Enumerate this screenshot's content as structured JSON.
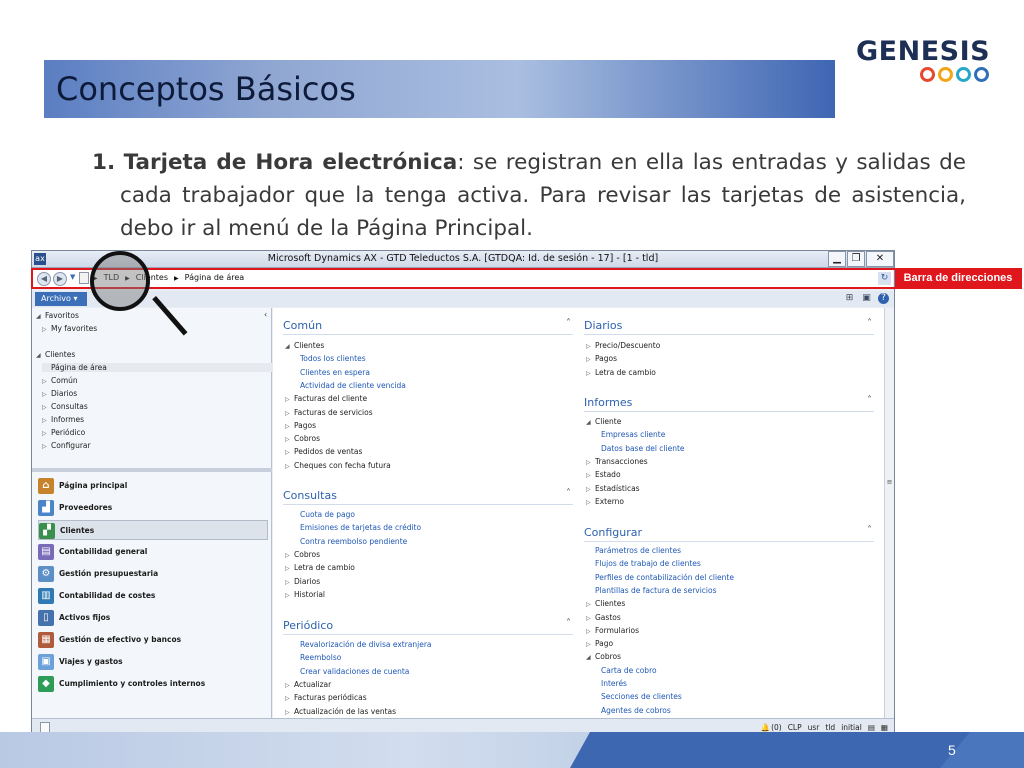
{
  "slide": {
    "title": "Conceptos Básicos",
    "logo_text": "GENESIS",
    "logo_ring_colors": [
      "#e64a2e",
      "#f2a516",
      "#26a7c9",
      "#2e6fb8"
    ],
    "page_number": "5"
  },
  "paragraph": {
    "number": "1.",
    "term": "Tarjeta de Hora electrónica",
    "text": ": se registran en ella las entradas y salidas de cada trabajador que la tenga activa. Para revisar las tarjetas de asistencia, debo ir al menú de la Página Principal."
  },
  "ax": {
    "window_title": "Microsoft Dynamics AX - GTD Teleductos S.A. [GTDQA: Id. de sesión - 17] -  [1 - tld]",
    "breadcrumbs": [
      "TLD",
      "Clientes",
      "Página de área"
    ],
    "callout_label": "Barra de direcciones",
    "archivo_label": "Archivo",
    "nav_tree": [
      {
        "label": "Favoritos",
        "kind": "group"
      },
      {
        "label": "My favorites",
        "kind": "child"
      },
      {
        "label": "Clientes",
        "kind": "group"
      },
      {
        "label": "Página de área",
        "kind": "selected"
      },
      {
        "label": "Común",
        "kind": "child"
      },
      {
        "label": "Diarios",
        "kind": "child"
      },
      {
        "label": "Consultas",
        "kind": "child"
      },
      {
        "label": "Informes",
        "kind": "child"
      },
      {
        "label": "Periódico",
        "kind": "child"
      },
      {
        "label": "Configurar",
        "kind": "child"
      }
    ],
    "modules": [
      {
        "label": "Página principal",
        "icon": "home-icon"
      },
      {
        "label": "Proveedores",
        "icon": "vendors-icon"
      },
      {
        "label": "Clientes",
        "icon": "customers-icon"
      },
      {
        "label": "Contabilidad general",
        "icon": "ledger-icon"
      },
      {
        "label": "Gestión presupuestaria",
        "icon": "budget-icon"
      },
      {
        "label": "Contabilidad de costes",
        "icon": "cost-icon"
      },
      {
        "label": "Activos fijos",
        "icon": "fixed-assets-icon"
      },
      {
        "label": "Gestión de efectivo y bancos",
        "icon": "bank-icon"
      },
      {
        "label": "Viajes y gastos",
        "icon": "travel-icon"
      },
      {
        "label": "Cumplimiento y controles internos",
        "icon": "compliance-icon"
      }
    ],
    "comun": {
      "title": "Común",
      "items": [
        {
          "label": "Clientes",
          "type": "open"
        },
        {
          "label": "Todos los clientes",
          "type": "link"
        },
        {
          "label": "Clientes en espera",
          "type": "link"
        },
        {
          "label": "Actividad de cliente vencida",
          "type": "link"
        },
        {
          "label": "Facturas del cliente",
          "type": "closed"
        },
        {
          "label": "Facturas de servicios",
          "type": "closed"
        },
        {
          "label": "Pagos",
          "type": "closed"
        },
        {
          "label": "Cobros",
          "type": "closed"
        },
        {
          "label": "Pedidos de ventas",
          "type": "closed"
        },
        {
          "label": "Cheques con fecha futura",
          "type": "closed"
        }
      ]
    },
    "consultas": {
      "title": "Consultas",
      "items": [
        {
          "label": "Cuota de pago",
          "type": "link"
        },
        {
          "label": "Emisiones de tarjetas de crédito",
          "type": "link"
        },
        {
          "label": "Contra reembolso pendiente",
          "type": "link"
        },
        {
          "label": "Cobros",
          "type": "closed"
        },
        {
          "label": "Letra de cambio",
          "type": "closed"
        },
        {
          "label": "Diarios",
          "type": "closed"
        },
        {
          "label": "Historial",
          "type": "closed"
        }
      ]
    },
    "periodico": {
      "title": "Periódico",
      "items": [
        {
          "label": "Revalorización de divisa extranjera",
          "type": "link"
        },
        {
          "label": "Reembolso",
          "type": "link"
        },
        {
          "label": "Crear validaciones de cuenta",
          "type": "link"
        },
        {
          "label": "Actualizar",
          "type": "closed"
        },
        {
          "label": "Facturas periódicas",
          "type": "closed"
        },
        {
          "label": "Actualización de las ventas",
          "type": "closed"
        }
      ]
    },
    "diarios": {
      "title": "Diarios",
      "items": [
        {
          "label": "Precio/Descuento",
          "type": "closed"
        },
        {
          "label": "Pagos",
          "type": "closed"
        },
        {
          "label": "Letra de cambio",
          "type": "closed"
        }
      ]
    },
    "informes": {
      "title": "Informes",
      "items": [
        {
          "label": "Cliente",
          "type": "open"
        },
        {
          "label": "Empresas cliente",
          "type": "link"
        },
        {
          "label": "Datos base del cliente",
          "type": "link"
        },
        {
          "label": "Transacciones",
          "type": "closed"
        },
        {
          "label": "Estado",
          "type": "closed"
        },
        {
          "label": "Estadísticas",
          "type": "closed"
        },
        {
          "label": "Externo",
          "type": "closed"
        }
      ]
    },
    "configurar": {
      "title": "Configurar",
      "items": [
        {
          "label": "Parámetros de clientes",
          "type": "link0"
        },
        {
          "label": "Flujos de trabajo de clientes",
          "type": "link0"
        },
        {
          "label": "Perfiles de contabilización del cliente",
          "type": "link0"
        },
        {
          "label": "Plantillas de factura de servicios",
          "type": "link0"
        },
        {
          "label": "Clientes",
          "type": "closed"
        },
        {
          "label": "Gastos",
          "type": "closed"
        },
        {
          "label": "Formularios",
          "type": "closed"
        },
        {
          "label": "Pago",
          "type": "closed"
        },
        {
          "label": "Cobros",
          "type": "open"
        },
        {
          "label": "Carta de cobro",
          "type": "link"
        },
        {
          "label": "Interés",
          "type": "link"
        },
        {
          "label": "Secciones de clientes",
          "type": "link"
        },
        {
          "label": "Agentes de cobros",
          "type": "link"
        }
      ]
    },
    "status": {
      "alerts": "(0)",
      "currency": "CLP",
      "user": "usr",
      "company": "tld",
      "layer": "initial"
    }
  }
}
